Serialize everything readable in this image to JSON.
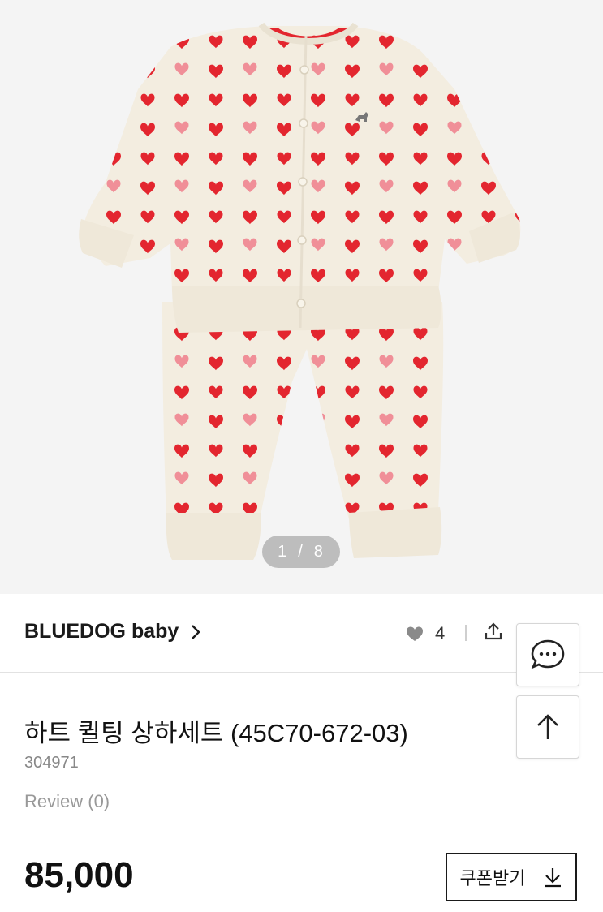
{
  "gallery": {
    "image_alt": "quilted heart print cardigan and pants set",
    "current": "1",
    "separator": "/",
    "total": "8"
  },
  "brand": {
    "name": "BLUEDOG baby",
    "chevron_icon": "chevron-right-icon"
  },
  "actions": {
    "like_count": "4",
    "like_icon": "heart-icon",
    "share_icon": "share-icon",
    "chat_icon": "chat-bubble-icon",
    "scroll_top_icon": "arrow-up-icon"
  },
  "product": {
    "title": "하트 퀼팅 상하세트 (45C70-672-03)",
    "code": "304971",
    "review": "Review (0)",
    "price": "85,000"
  },
  "coupon": {
    "label": "쿠폰받기",
    "icon": "download-icon"
  },
  "colors": {
    "heart_red": "#e3262f",
    "heart_pink": "#f08f98",
    "fabric": "#f3ede0",
    "background": "#f4f4f4"
  }
}
